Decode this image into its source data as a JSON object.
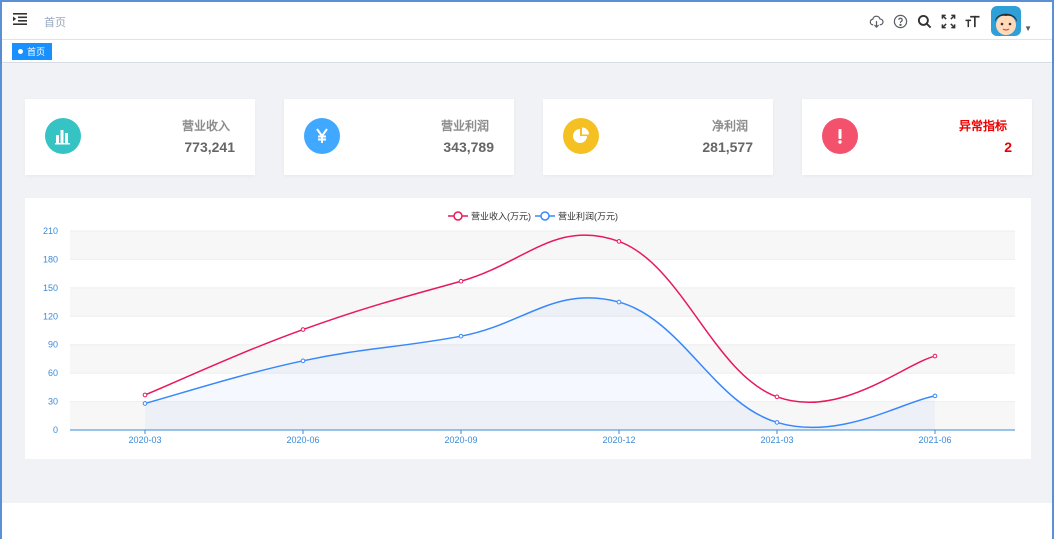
{
  "header": {
    "breadcrumb": "首页"
  },
  "tags": {
    "active_label": "首页"
  },
  "cards": [
    {
      "title": "营业收入",
      "value": "773,241",
      "icon": "bar-chart-icon",
      "color": "#36c3c3",
      "title_color": "#8c8c8c",
      "value_color": "#666666"
    },
    {
      "title": "营业利润",
      "value": "343,789",
      "icon": "yen-icon",
      "color": "#40a9ff",
      "title_color": "#8c8c8c",
      "value_color": "#666666"
    },
    {
      "title": "净利润",
      "value": "281,577",
      "icon": "pie-chart-icon",
      "color": "#f4c022",
      "title_color": "#8c8c8c",
      "value_color": "#666666"
    },
    {
      "title": "异常指标",
      "value": "2",
      "icon": "exclamation-icon",
      "color": "#f4516c",
      "title_color": "#ee0000",
      "value_color": "#ee0000"
    }
  ],
  "chart_data": {
    "type": "line",
    "categories": [
      "2020-03",
      "2020-06",
      "2020-09",
      "2020-12",
      "2021-03",
      "2021-06"
    ],
    "series": [
      {
        "name": "营业收入(万元)",
        "values": [
          37,
          106,
          157,
          199,
          35,
          78
        ],
        "color": "#e8195a",
        "area": false
      },
      {
        "name": "营业利润(万元)",
        "values": [
          28,
          73,
          99,
          135,
          8,
          36
        ],
        "color": "#3888fa",
        "area": true
      }
    ],
    "yticks": [
      0,
      30,
      60,
      90,
      120,
      150,
      180,
      210
    ],
    "ylim": [
      0,
      210
    ],
    "legend": "top-center",
    "grid": true,
    "smooth": true
  }
}
